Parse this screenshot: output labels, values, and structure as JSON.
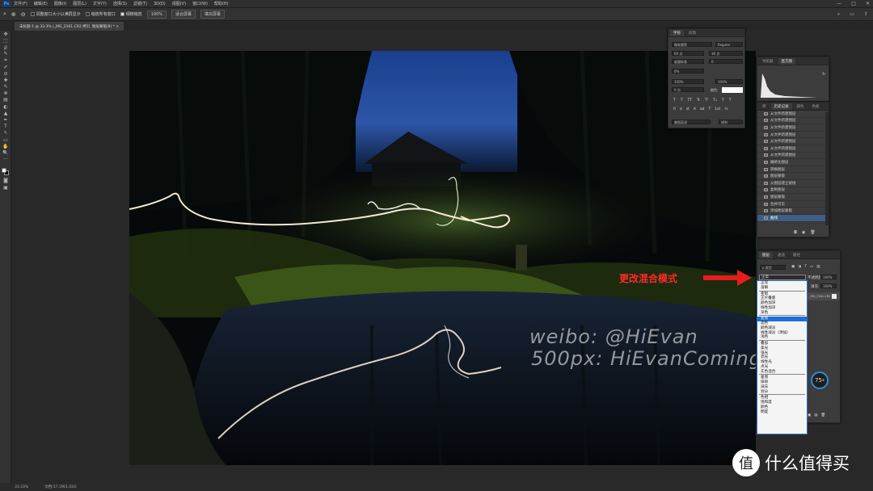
{
  "menubar": {
    "app_badge": "Ps",
    "items": [
      "文件(F)",
      "编辑(E)",
      "图像(I)",
      "图层(L)",
      "文字(Y)",
      "选择(S)",
      "滤镜(T)",
      "3D(D)",
      "视图(V)",
      "窗口(W)",
      "帮助(H)"
    ],
    "window_controls": [
      "—",
      "□",
      "✕"
    ]
  },
  "options_bar": {
    "zoom_in_icon": "⊕",
    "zoom_out_icon": "⊖",
    "resize_windows_label": "调整窗口大小以满屏显示",
    "zoom_all_windows_label": "缩放所有窗口",
    "scrubby_zoom_label": "细微缩放",
    "zoom_100_label": "100%",
    "fit_screen_label": "适合屏幕",
    "fill_screen_label": "填充屏幕"
  },
  "document_tab": {
    "title": "未标题-1 @ 33.3% (_MG_2161.CR2 拷贝, 图层蒙版/8) * ×"
  },
  "toolbar": {
    "tools": [
      "✥",
      "⬚",
      "ϼ",
      "✎",
      "⌗",
      "✐",
      "⊘",
      "✚",
      "✎",
      "⊗",
      "▤",
      "◐",
      "▲",
      "✒",
      "T",
      "↖",
      "▭",
      "✋",
      "🔍",
      "···"
    ]
  },
  "character_panel": {
    "tabs": [
      "字符",
      "段落"
    ],
    "font_family": "微软雅黑",
    "font_style": "Regular",
    "font_size": "60 点",
    "leading": "36 点",
    "kerning": "度量标准",
    "tracking": "0",
    "scale_v": "100%",
    "scale_h": "100%",
    "baseline": "0 点",
    "color_label": "颜色:",
    "style_buttons": [
      "T",
      "T",
      "TT",
      "Tr",
      "T¹",
      "T₁",
      "T",
      "T"
    ],
    "ligature_buttons": [
      "fi",
      "σ",
      "st",
      "A",
      "ad",
      "T",
      "1st",
      "½"
    ],
    "language": "美国英语",
    "antialias": "锐利",
    "percent": "0%"
  },
  "history_panel": {
    "top_tabs": [
      "导航器",
      "直方图"
    ],
    "tabs": [
      "库",
      "历史记录",
      "颜色",
      "色板"
    ],
    "items": [
      "从文件新建图层",
      "从文件新建图层",
      "从文件新建图层",
      "从文件新建图层",
      "从文件新建图层",
      "从文件新建图层",
      "从文件新建图层",
      "栅格化图层",
      "转换图层",
      "图层蒙版",
      "从图层建立链接",
      "复制图层",
      "图层蒙版",
      "合并可见",
      "添加图层蒙版",
      "曲线"
    ]
  },
  "layers_panel": {
    "tabs": [
      "图层",
      "通道",
      "路径"
    ],
    "kind_label": "p 类型",
    "blend_mode": "正常",
    "opacity_label": "不透明度:",
    "opacity_value": "100%",
    "fill_label": "填充:",
    "fill_value": "100%",
    "layer_name": "_MG_2161.CR2 拷贝",
    "bottom_icons": [
      "⛓",
      "fx",
      "◘",
      "◑",
      "▣",
      "▤",
      "🗑"
    ]
  },
  "blend_dropdown": {
    "groups": [
      [
        "正常",
        "溶解"
      ],
      [
        "变暗",
        "正片叠底",
        "颜色加深",
        "线性加深",
        "深色"
      ],
      [
        "变亮",
        "滤色",
        "颜色减淡",
        "线性减淡（添加）",
        "浅色"
      ],
      [
        "叠加",
        "柔光",
        "强光",
        "亮光",
        "线性光",
        "点光",
        "实色混合"
      ],
      [
        "差值",
        "排除",
        "减去",
        "划分"
      ],
      [
        "色相",
        "饱和度",
        "颜色",
        "明度"
      ]
    ],
    "selected": "变亮"
  },
  "annotation": {
    "text": "更改混合模式",
    "color": "#ff2a2a"
  },
  "watermark": {
    "line1": "weibo: @HiEvan",
    "line2": "500px: HiEvanComing"
  },
  "gauge": {
    "value": "75",
    "unit": "x"
  },
  "status_bar": {
    "zoom": "33.33%",
    "doc_info": "文档:57.1M/1.02G"
  },
  "brand": {
    "badge": "值",
    "text": "什么值得买"
  }
}
